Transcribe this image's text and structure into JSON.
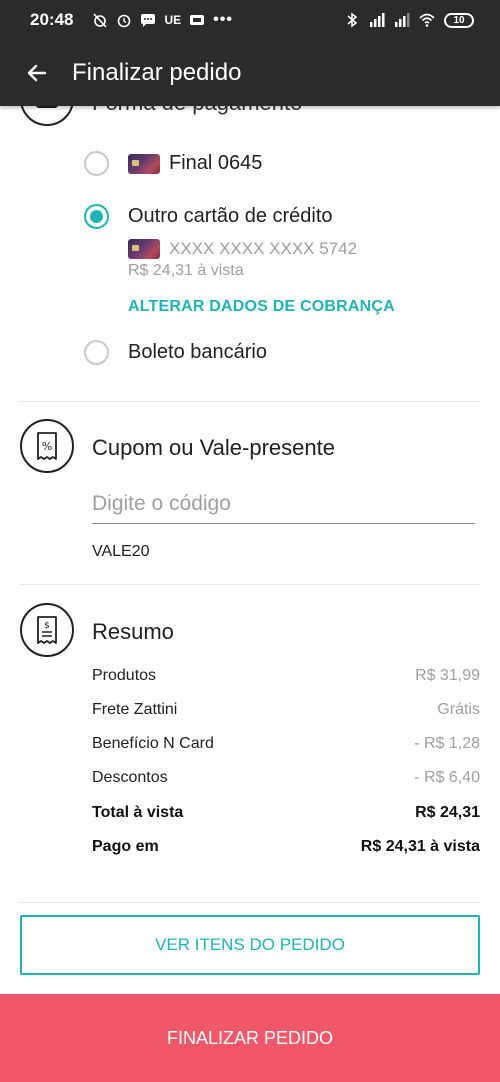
{
  "status_bar": {
    "time": "20:48",
    "carrier": "UE",
    "battery": "10"
  },
  "app_bar": {
    "title": "Finalizar pedido"
  },
  "payment": {
    "title_partial": "Forma de pagamento",
    "options": [
      {
        "label": "Final 0645",
        "selected": false
      },
      {
        "label": "Outro cartão de crédito",
        "selected": true
      },
      {
        "label": "Boleto bancário",
        "selected": false
      }
    ],
    "card_number": "XXXX XXXX XXXX 5742",
    "price_note": "R$ 24,31 à vista",
    "change_billing": "ALTERAR DADOS DE COBRANÇA"
  },
  "coupon": {
    "title": "Cupom ou Vale-presente",
    "placeholder": "Digite o código",
    "applied_code": "VALE20"
  },
  "summary": {
    "title": "Resumo",
    "rows": [
      {
        "label": "Produtos",
        "value": "R$ 31,99"
      },
      {
        "label": "Frete Zattini",
        "value": "Grátis"
      },
      {
        "label": "Benefício N Card",
        "value": "- R$ 1,28"
      },
      {
        "label": "Descontos",
        "value": "- R$ 6,40"
      },
      {
        "label": "Total à vista",
        "value": "R$ 24,31"
      },
      {
        "label": "Pago em",
        "value": "R$ 24,31 à vista"
      }
    ]
  },
  "actions": {
    "view_items": "VER ITENS DO PEDIDO",
    "finalize": "FINALIZAR PEDIDO"
  },
  "colors": {
    "accent": "#1eb4b4",
    "primary_button": "#f0586a",
    "app_bar": "#2b2b2b"
  }
}
